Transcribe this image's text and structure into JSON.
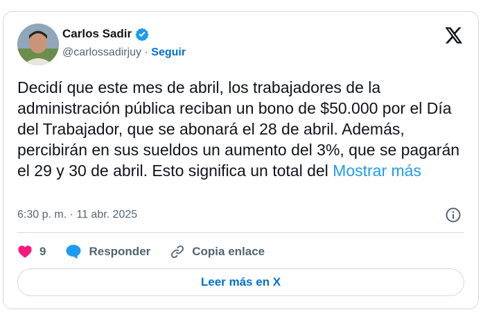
{
  "author": {
    "name": "Carlos Sadir",
    "handle": "@carlossadirjuy",
    "separator": "·",
    "follow_label": "Seguir"
  },
  "tweet": {
    "text": "Decidí que este mes de abril, los trabajadores de la administración pública reciban un bono de $50.000 por el Día del Trabajador, que se abonará el 28 de abril. Además, percibirán en sus sueldos un aumento del 3%, que se pagarán el 29 y 30 de abril. Esto significa un total del ",
    "show_more": "Mostrar más",
    "timestamp": "6:30 p. m. · 11 abr. 2025"
  },
  "actions": {
    "likes": "9",
    "reply_label": "Responder",
    "copy_link_label": "Copia enlace"
  },
  "read_more_label": "Leer más en X",
  "colors": {
    "accent": "#006fd6",
    "link": "#1d9bf0",
    "like": "#f91880",
    "muted": "#536471",
    "border": "#cfd9de"
  }
}
